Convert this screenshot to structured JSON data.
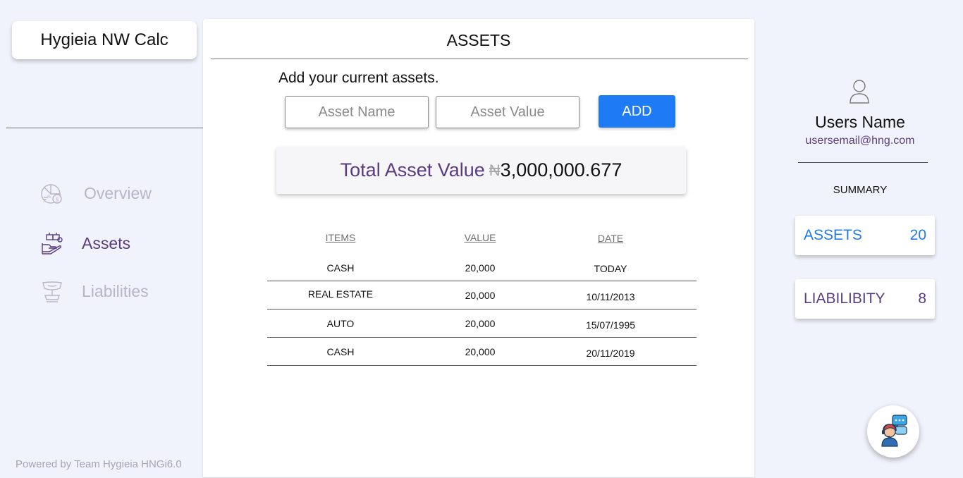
{
  "app": {
    "brand": "Hygieia NW Calc",
    "footer": "Powered by Team Hygieia  HNGi6.0"
  },
  "sidebar": {
    "items": [
      {
        "label": "Overview",
        "icon": "overview-chart-icon",
        "active": false
      },
      {
        "label": "Assets",
        "icon": "assets-icon",
        "active": true
      },
      {
        "label": "Liabilities",
        "icon": "liabilities-icon",
        "active": false
      }
    ]
  },
  "main": {
    "title": "ASSETS",
    "subtitle": "Add your current assets.",
    "inputs": {
      "name_placeholder": "Asset Name",
      "value_placeholder": "Asset Value",
      "name_value": "",
      "value_value": ""
    },
    "add_label": "ADD",
    "total": {
      "label": "Total Asset Value",
      "currency": "₦",
      "amount": "3,000,000.677"
    },
    "table": {
      "headers": [
        "ITEMS",
        "VALUE",
        "DATE"
      ],
      "rows": [
        {
          "item": "CASH",
          "value": "20,000",
          "date": "TODAY"
        },
        {
          "item": "REAL ESTATE",
          "value": "20,000",
          "date": "10/11/2013"
        },
        {
          "item": "AUTO",
          "value": "20,000",
          "date": "15/07/1995"
        },
        {
          "item": "CASH",
          "value": "20,000",
          "date": "20/11/2019"
        }
      ]
    }
  },
  "user": {
    "name": "Users Name",
    "email": "usersemail@hng.com"
  },
  "summary": {
    "title": "SUMMARY",
    "assets": {
      "label": "ASSETS",
      "count": "20"
    },
    "liabilities": {
      "label": "LIABILIBITY",
      "count": "8"
    }
  },
  "colors": {
    "accent_blue": "#1f7bf5",
    "accent_purple": "#5a3d80",
    "background": "#f1f3fc"
  }
}
